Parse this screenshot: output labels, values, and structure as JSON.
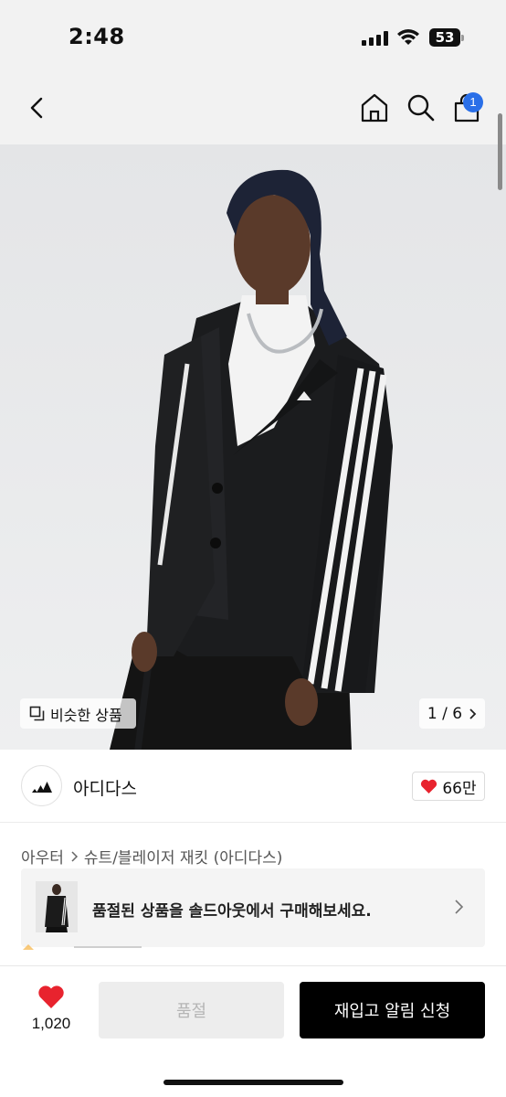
{
  "status": {
    "time": "2:48",
    "battery": "53"
  },
  "header": {
    "back_icon": "chevron-left-icon",
    "home_icon": "home-icon",
    "search_icon": "search-icon",
    "cart_icon": "shopping-bag-icon",
    "cart_badge": "1"
  },
  "product_image": {
    "similar_label": "비슷한 상품",
    "page_indicator": "1 / 6"
  },
  "brand": {
    "name": "아디다스",
    "likes": "66만"
  },
  "breadcrumb": {
    "category": "아우터",
    "subcategory": "슈트/블레이저 재킷 (아디다스)"
  },
  "banner": {
    "text": "품절된 상품을 솔드아웃에서 구매해보세요."
  },
  "bottom": {
    "favorite_count": "1,020",
    "soldout_label": "품절",
    "restock_label": "재입고 알림 신청"
  },
  "colors": {
    "accent_blue": "#2a6fe8",
    "heart_red": "#e8232e",
    "primary_black": "#000000"
  }
}
